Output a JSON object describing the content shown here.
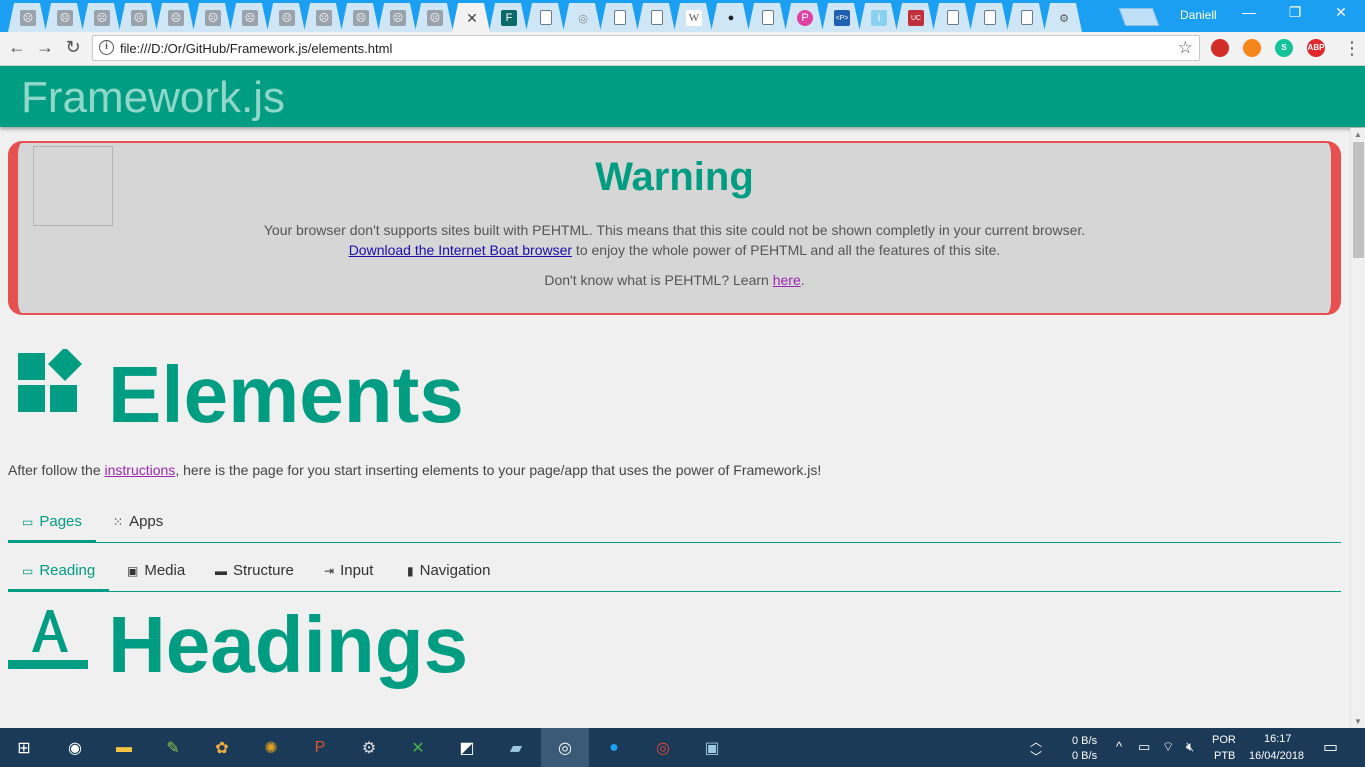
{
  "browser": {
    "profile_name": "Daniell",
    "url": "file:///D:/Or/GitHub/Framework.js/elements.html",
    "tab_favicons": [
      "err",
      "err",
      "err",
      "err",
      "err",
      "err",
      "err",
      "err",
      "err",
      "err",
      "err",
      "err",
      "close",
      "F",
      "doc",
      "disc",
      "doc",
      "doc",
      "W",
      "gh",
      "doc",
      "P",
      "<P>",
      "i",
      "UC",
      "doc",
      "doc",
      "doc",
      "gear"
    ],
    "extensions": [
      {
        "name": "lastpass-icon",
        "color": "#d32d27",
        "label": ""
      },
      {
        "name": "metamask-icon",
        "color": "#f6851b",
        "label": ""
      },
      {
        "name": "grammarly-icon",
        "color": "#15c39a",
        "label": "S"
      },
      {
        "name": "adblock-icon",
        "color": "#e0282f",
        "label": "ABP"
      }
    ]
  },
  "app": {
    "brand": "Framework.js"
  },
  "warning": {
    "title": "Warning",
    "line1": "Your browser don't supports sites built with PEHTML. This means that this site could not be shown completly in your current browser.",
    "download_link": "Download the Internet Boat browser",
    "line2_rest": " to enjoy the whole power of PEHTML and all the features of this site.",
    "line3_pre": "Don't know what is PEHTML? Learn ",
    "line3_link": "here",
    "line3_post": "."
  },
  "page": {
    "title": "Elements",
    "intro_pre": "After follow the ",
    "intro_link": "instructions",
    "intro_post": ", here is the page for you start inserting elements to your page/app that uses the power of Framework.js!",
    "section_title": "Headings"
  },
  "tabs_top": [
    {
      "label": "Pages",
      "icon": "▭",
      "active": true
    },
    {
      "label": "Apps",
      "icon": "⁙",
      "active": false
    }
  ],
  "tabs_sub": [
    {
      "label": "Reading",
      "icon": "▭",
      "active": true
    },
    {
      "label": "Media",
      "icon": "▣",
      "active": false
    },
    {
      "label": "Structure",
      "icon": "▬",
      "active": false
    },
    {
      "label": "Input",
      "icon": "⇥",
      "active": false
    },
    {
      "label": "Navigation",
      "icon": "▮",
      "active": false
    }
  ],
  "taskbar": {
    "net_up": "0 B/s",
    "net_down": "0 B/s",
    "lang1": "POR",
    "lang2": "PTB",
    "time": "16:17",
    "date": "16/04/2018"
  },
  "colors": {
    "accent": "#009d83",
    "warning_border": "#e84f4f",
    "titlebar": "#1a9ff2",
    "taskbar": "#1b3a57"
  }
}
